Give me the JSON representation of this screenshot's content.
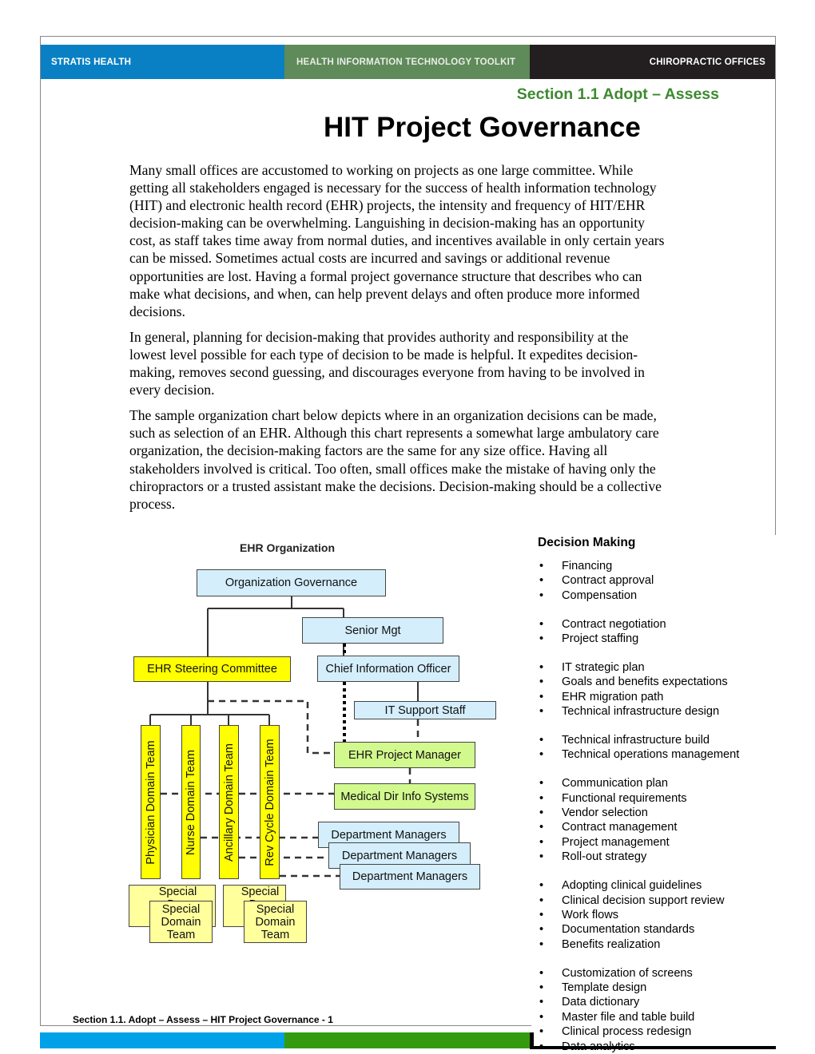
{
  "header": {
    "left": "STRATIS HEALTH",
    "center": "HEALTH INFORMATION TECHNOLOGY TOOLKIT",
    "right": "CHIROPRACTIC OFFICES"
  },
  "section": "Section 1.1 Adopt – Assess",
  "title": "HIT Project Governance",
  "paragraphs": [
    "Many small offices are accustomed to working on projects as one large committee. While getting all stakeholders engaged is necessary for the success of health information technology (HIT) and electronic health record (EHR) projects, the intensity and frequency of HIT/EHR decision-making can be overwhelming. Languishing in decision-making has an opportunity cost, as staff takes time away from normal duties, and incentives available in only certain years can be missed. Sometimes actual costs are incurred and savings or additional revenue opportunities are lost. Having a formal project governance structure that describes who can make what decisions, and when, can help prevent delays and often produce more informed decisions.",
    "In general, planning for decision-making that provides authority and responsibility at the lowest level possible for each type of decision to be made is helpful. It expedites decision-making, removes second guessing, and discourages everyone from having to be involved in every decision.",
    "The sample organization chart below depicts where in an organization decisions can be made, such as selection of an EHR. Although this chart represents a somewhat large ambulatory care organization, the decision-making factors are the same for any size office. Having all stakeholders involved is critical. Too often, small offices make the mistake of having only the chiropractors or a trusted assistant make the decisions. Decision-making should be a collective process."
  ],
  "org_chart": {
    "title": "EHR Organization",
    "governance": "Organization Governance",
    "senior_mgt": "Senior Mgt",
    "steering": "EHR Steering Committee",
    "cio": "Chief Information Officer",
    "it_support": "IT Support Staff",
    "project_manager": "EHR Project Manager",
    "medical_dir": "Medical Dir Info Systems",
    "dept_managers": "Department Managers",
    "domain_teams": [
      "Physician Domain Team",
      "Nurse Domain Team",
      "Ancillary Domain Team",
      "Rev Cycle Domain Team"
    ],
    "special_team": [
      "Special",
      "Domain",
      "Team"
    ],
    "special_back_partial": [
      "Special",
      "Do",
      "T"
    ]
  },
  "decision_making": {
    "title": "Decision Making",
    "groups": [
      [
        "Financing",
        "Contract approval",
        "Compensation"
      ],
      [
        "Contract negotiation",
        "Project staffing"
      ],
      [
        "IT strategic plan",
        "Goals and benefits expectations",
        "EHR migration path",
        "Technical infrastructure design"
      ],
      [
        "Technical infrastructure build",
        "Technical operations management"
      ],
      [
        "Communication plan",
        "Functional requirements",
        "Vendor selection",
        "Contract management",
        "Project management",
        "Roll-out strategy"
      ],
      [
        "Adopting clinical guidelines",
        "Clinical decision support review",
        "Work flows",
        "Documentation standards",
        "Benefits realization"
      ],
      [
        "Customization of screens",
        "Template design",
        "Data dictionary",
        "Master file and table build",
        "Clinical process redesign",
        "Data analytics"
      ]
    ]
  },
  "footer": "Section 1.1. Adopt – Assess – HIT Project Governance - 1",
  "colors": {
    "blue": "#0a80c4",
    "green_header": "#5f8a59",
    "dark": "#231f20",
    "section_green": "#3d8a2f",
    "box_blue": "#d4eefc",
    "box_yellow": "#ffff00",
    "box_green": "#d2f98e"
  }
}
